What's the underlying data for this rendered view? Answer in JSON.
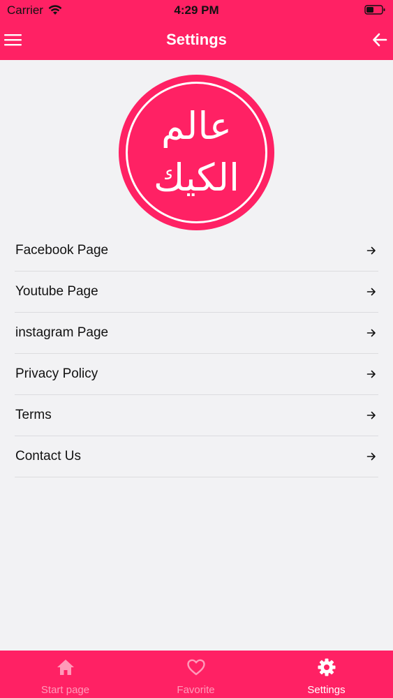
{
  "status_bar": {
    "carrier": "Carrier",
    "time": "4:29 PM",
    "wifi_icon": "wifi-icon",
    "battery_icon": "battery-icon"
  },
  "header": {
    "title": "Settings",
    "menu_icon": "hamburger-menu-icon",
    "back_icon": "arrow-left-icon",
    "background_color": "#ff2164"
  },
  "logo": {
    "line1": "عالم",
    "line2": "الكيك",
    "circle_color": "#ff2164",
    "text_color": "#ffffff"
  },
  "settings_list": {
    "items": [
      {
        "label": "Facebook Page",
        "icon": "arrow-right-icon"
      },
      {
        "label": "Youtube Page",
        "icon": "arrow-right-icon"
      },
      {
        "label": "instagram Page",
        "icon": "arrow-right-icon"
      },
      {
        "label": "Privacy Policy",
        "icon": "arrow-right-icon"
      },
      {
        "label": "Terms",
        "icon": "arrow-right-icon"
      },
      {
        "label": "Contact Us",
        "icon": "arrow-right-icon"
      }
    ]
  },
  "tab_bar": {
    "tabs": [
      {
        "label": "Start page",
        "icon": "home-icon",
        "active": false
      },
      {
        "label": "Favorite",
        "icon": "heart-icon",
        "active": false
      },
      {
        "label": "Settings",
        "icon": "gear-icon",
        "active": true
      }
    ]
  }
}
